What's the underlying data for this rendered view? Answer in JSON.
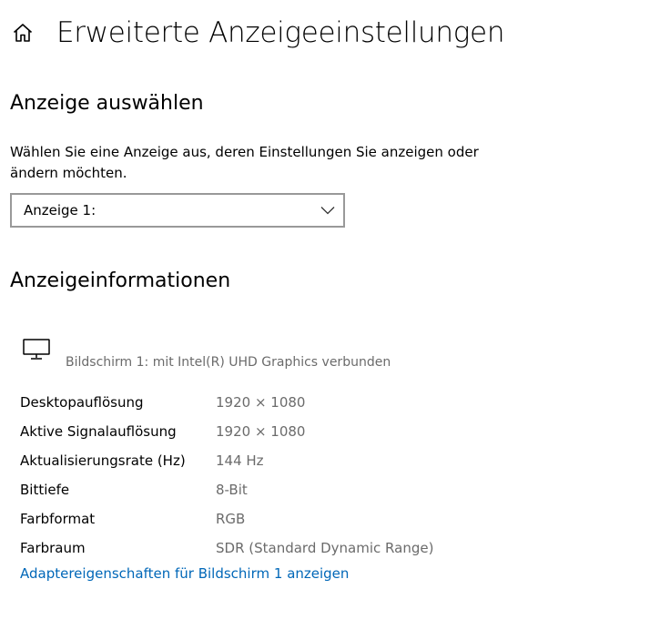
{
  "header": {
    "home_icon": "home-icon",
    "title": "Erweiterte Anzeigeeinstellungen"
  },
  "select_display": {
    "section_title": "Anzeige auswählen",
    "description": "Wählen Sie eine Anzeige aus, deren Einstellungen Sie anzeigen oder ändern möchten.",
    "dropdown_value": "Anzeige 1:",
    "dropdown_icon": "chevron-down-icon"
  },
  "display_info": {
    "section_title": "Anzeigeinformationen",
    "monitor_icon": "monitor-icon",
    "monitor_label": "Bildschirm 1: mit Intel(R) UHD Graphics verbunden",
    "rows": [
      {
        "key": "Desktopauflösung",
        "value": "1920 × 1080"
      },
      {
        "key": "Aktive Signalauflösung",
        "value": "1920 × 1080"
      },
      {
        "key": "Aktualisierungsrate (Hz)",
        "value": "144 Hz"
      },
      {
        "key": "Bittiefe",
        "value": "8-Bit"
      },
      {
        "key": "Farbformat",
        "value": "RGB"
      },
      {
        "key": "Farbraum",
        "value": "SDR (Standard Dynamic Range)"
      }
    ],
    "adapter_link": "Adaptereigenschaften für Bildschirm 1 anzeigen"
  },
  "colors": {
    "link": "#0067b8",
    "secondary_text": "#6b6b6b",
    "dropdown_border": "#999999"
  }
}
